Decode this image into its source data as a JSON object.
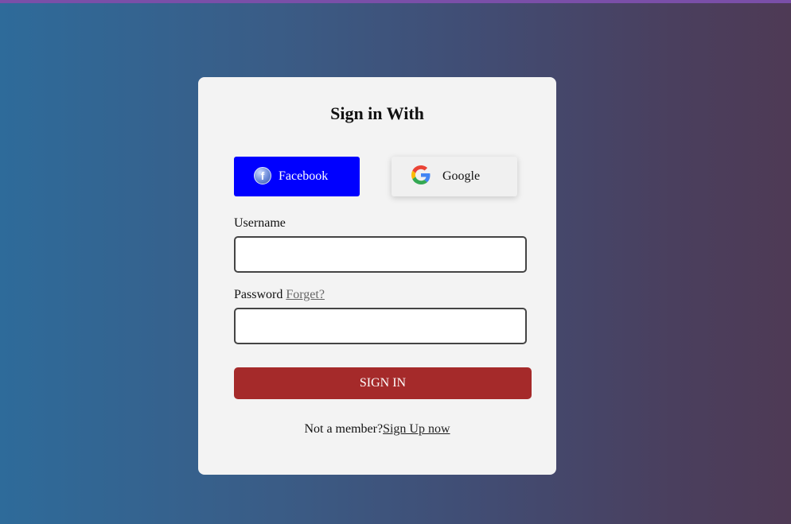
{
  "heading": "Sign in With",
  "social": {
    "facebook_label": "Facebook",
    "facebook_icon": "facebook-icon",
    "facebook_color": "#0000ff",
    "google_label": "Google",
    "google_icon": "google-icon"
  },
  "form": {
    "username_label": "Username",
    "username_value": "",
    "password_label": "Password",
    "forget_link": "Forget?",
    "password_value": "",
    "submit_label": "SIGN IN",
    "submit_color": "#a52a2a"
  },
  "footer": {
    "text": "Not a member?",
    "signup_link": "Sign Up now"
  }
}
